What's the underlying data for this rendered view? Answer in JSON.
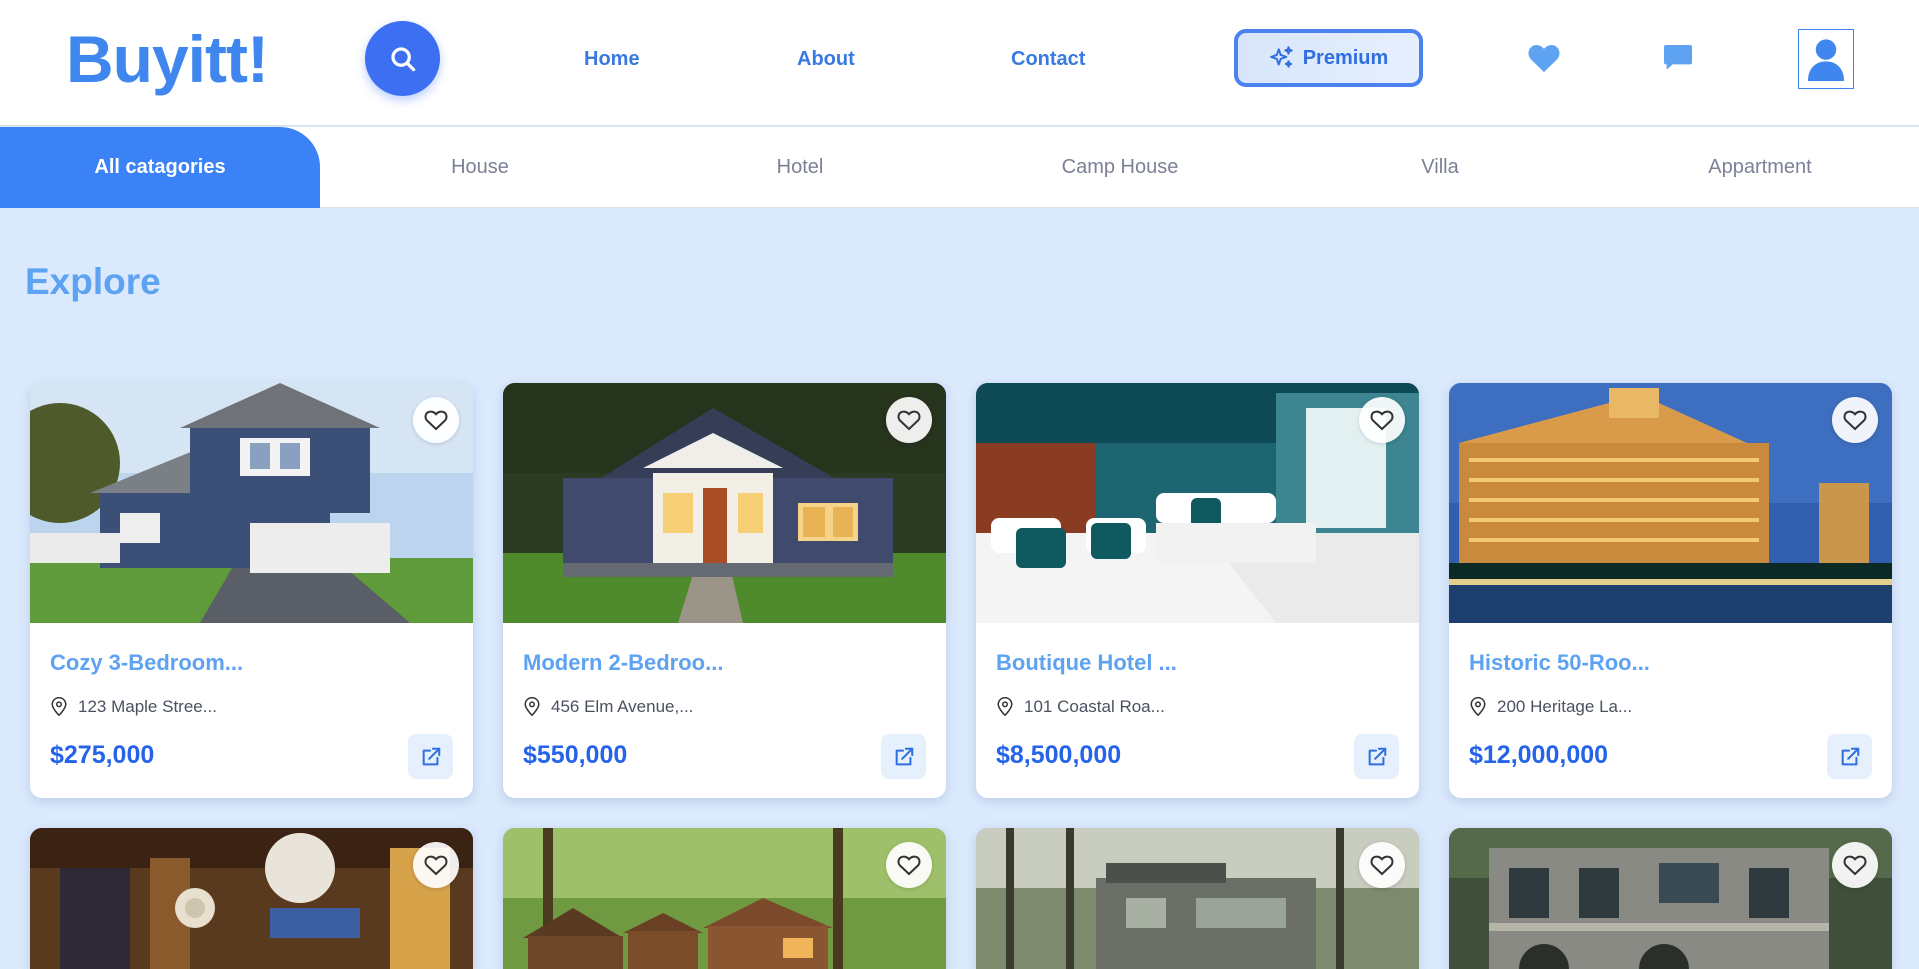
{
  "header": {
    "logo": "Buyitt!",
    "nav": [
      {
        "label": "Home"
      },
      {
        "label": "About"
      },
      {
        "label": "Contact"
      }
    ],
    "premium_label": "Premium"
  },
  "categories": [
    {
      "label": "All catagories",
      "active": true
    },
    {
      "label": "House",
      "active": false
    },
    {
      "label": "Hotel",
      "active": false
    },
    {
      "label": "Camp House",
      "active": false
    },
    {
      "label": "Villa",
      "active": false
    },
    {
      "label": "Appartment",
      "active": false
    }
  ],
  "explore": {
    "title": "Explore"
  },
  "listings": [
    {
      "title": "Cozy 3-Bedroom...",
      "location": "123 Maple Stree...",
      "price": "$275,000"
    },
    {
      "title": "Modern 2-Bedroo...",
      "location": "456 Elm Avenue,...",
      "price": "$550,000"
    },
    {
      "title": "Boutique Hotel ...",
      "location": "101 Coastal Roa...",
      "price": "$8,500,000"
    },
    {
      "title": "Historic 50-Roo...",
      "location": "200 Heritage La...",
      "price": "$12,000,000"
    }
  ],
  "colors": {
    "brand": "#3f87ee",
    "accent": "#3b82f6",
    "price": "#2563eb",
    "page_bg": "#dbe9fd"
  }
}
